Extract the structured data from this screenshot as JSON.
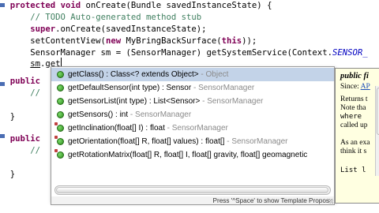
{
  "editor": {
    "lines": [
      [
        {
          "t": "  "
        },
        {
          "t": "protected",
          "c": "kw"
        },
        {
          "t": " "
        },
        {
          "t": "void",
          "c": "kw"
        },
        {
          "t": " onCreate(Bundle savedInstanceState) {"
        }
      ],
      [
        {
          "t": "      "
        },
        {
          "t": "// TODO Auto-generated method stub",
          "c": "cm"
        }
      ],
      [
        {
          "t": "      "
        },
        {
          "t": "super",
          "c": "kw"
        },
        {
          "t": ".onCreate(savedInstanceState);"
        }
      ],
      [
        {
          "t": "      setContentView("
        },
        {
          "t": "new",
          "c": "kw"
        },
        {
          "t": " MyBringBackSurface("
        },
        {
          "t": "this",
          "c": "kw"
        },
        {
          "t": "));"
        }
      ],
      [
        {
          "t": "      SensorManager sm = (SensorManager) getSystemService(Context."
        },
        {
          "t": "SENSOR_",
          "c": "fld"
        }
      ],
      [
        {
          "t": "      "
        },
        {
          "t": "sm",
          "c": "ul"
        },
        {
          "t": ".get"
        },
        {
          "t": "",
          "c": "cursor"
        }
      ],
      [
        {
          "t": "  "
        },
        {
          "t": "public",
          "c": "kw"
        }
      ],
      [
        {
          "t": "      "
        },
        {
          "t": "//",
          "c": "cm"
        }
      ],
      [
        {
          "t": ""
        }
      ],
      [
        {
          "t": "  }"
        }
      ],
      [
        {
          "t": ""
        }
      ],
      [
        {
          "t": "  "
        },
        {
          "t": "public",
          "c": "kw"
        }
      ],
      [
        {
          "t": "      "
        },
        {
          "t": "//",
          "c": "cm"
        }
      ],
      [
        {
          "t": ""
        }
      ],
      [
        {
          "t": "  }"
        }
      ]
    ]
  },
  "content_assist": {
    "proposals": [
      {
        "signature": "getClass() : Class<? extends Object>",
        "type": " - Object",
        "selected": true,
        "static": false
      },
      {
        "signature": "getDefaultSensor(int type) : Sensor",
        "type": " - SensorManager",
        "selected": false,
        "static": false
      },
      {
        "signature": "getSensorList(int type) : List<Sensor>",
        "type": " - SensorManager",
        "selected": false,
        "static": false
      },
      {
        "signature": "getSensors() : int",
        "type": " - SensorManager",
        "selected": false,
        "static": false
      },
      {
        "signature": "getInclination(float[] I) : float",
        "type": " - SensorManager",
        "selected": false,
        "static": true
      },
      {
        "signature": "getOrientation(float[] R, float[] values) : float[]",
        "type": " - SensorManager",
        "selected": false,
        "static": true
      },
      {
        "signature": "getRotationMatrix(float[] R, float[] I, float[] gravity, float[] geomagnetic",
        "type": "",
        "selected": false,
        "static": true
      }
    ],
    "footer_text": "Press '^Space' to show Template Propos"
  },
  "javadoc": {
    "title": "public fi",
    "since_label": "Since: ",
    "since_link": "AP",
    "lines": [
      "Returns t",
      "Note tha",
      "where ",
      "called up",
      "",
      "As an exa",
      "think it s",
      "",
      "List l"
    ]
  },
  "colors": {
    "keyword": "#7f0055",
    "comment": "#3f7f5f",
    "field": "#0000c0",
    "selection": "#c3d3e8",
    "doc_background": "#ffffe1"
  }
}
